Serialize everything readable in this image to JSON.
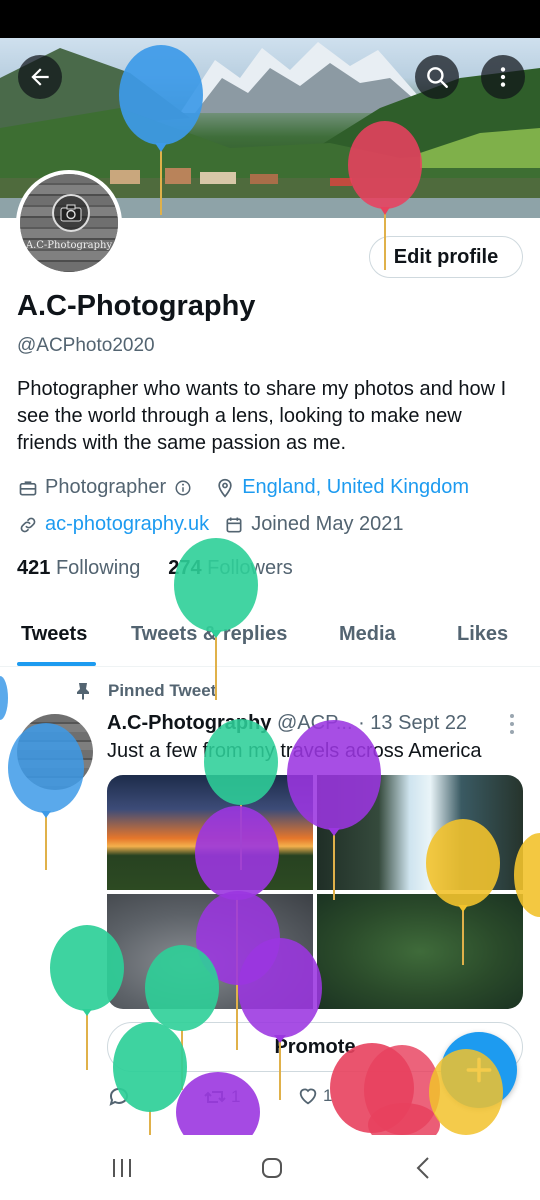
{
  "profile": {
    "name": "A.C-Photography",
    "handle": "@ACPhoto2020",
    "avatar_text": "A.C-Photography",
    "edit_label": "Edit profile",
    "bio": "Photographer who wants to share my photos and how I see the world through a lens,  looking to make new friends with the same passion as me.",
    "profession": "Photographer",
    "location": "England, United Kingdom",
    "website": "ac-photography.uk",
    "joined": "Joined May 2021",
    "following_count": "421",
    "following_label": "Following",
    "followers_count": "274",
    "followers_label": "Followers"
  },
  "tabs": [
    {
      "label": "Tweets",
      "active": true
    },
    {
      "label": "Tweets & replies",
      "active": false
    },
    {
      "label": "Media",
      "active": false
    },
    {
      "label": "Likes",
      "active": false
    }
  ],
  "tweet": {
    "pinned_label": "Pinned Tweet",
    "author": "A.C-Photography",
    "handle": "@ACP...",
    "date": "· 13 Sept 22",
    "text": "Just a few from my travels across America",
    "promote_label": "Promote",
    "retweets": "1",
    "likes": "1"
  },
  "icons": {
    "back": "arrow-left-icon",
    "search": "search-icon",
    "more": "more-vertical-icon",
    "profession": "briefcase-icon",
    "info": "info-icon",
    "location": "location-pin-icon",
    "link": "link-icon",
    "calendar": "calendar-icon",
    "pin": "pin-icon",
    "reply": "reply-icon",
    "retweet": "retweet-icon",
    "like": "heart-icon",
    "compose": "plus-icon"
  },
  "colors": {
    "accent": "#1d9bf0",
    "text": "#0f1419",
    "secondary": "#536471"
  }
}
